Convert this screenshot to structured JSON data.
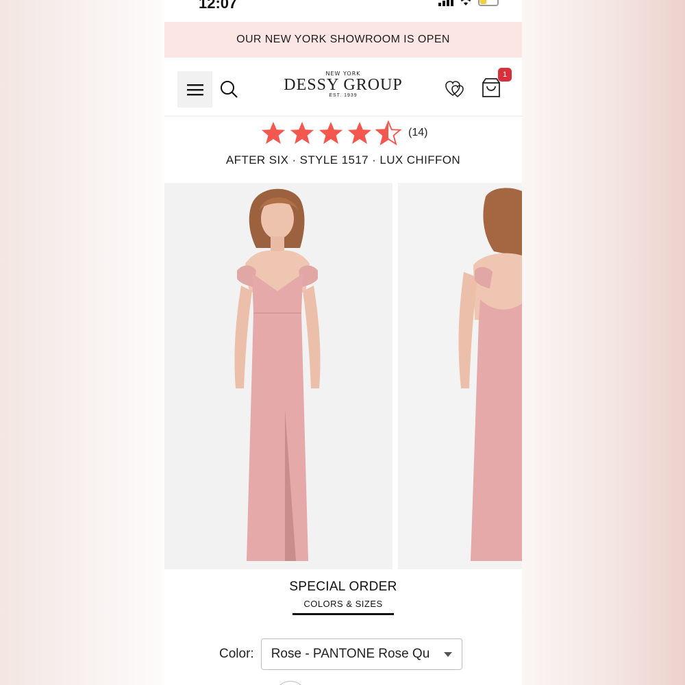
{
  "status": {
    "time": "12:07"
  },
  "banner": {
    "text": "OUR NEW YORK SHOWROOM IS OPEN"
  },
  "header": {
    "logo_top": "NEW YORK",
    "logo_main": "DESSY GROUP",
    "logo_est": "EST. 1939",
    "cart_count": "1",
    "icons": [
      "menu-icon",
      "search-icon",
      "wishlist-hearts-icon",
      "shopping-bag-icon"
    ]
  },
  "rating": {
    "stars": 4.5,
    "max": 5,
    "count_label": "(14)",
    "star_color": "#f4574d"
  },
  "product": {
    "line": "AFTER SIX · STYLE 1517 · LUX CHIFFON"
  },
  "tabs": {
    "title": "SPECIAL ORDER",
    "subtitle": "COLORS & SIZES"
  },
  "color": {
    "label": "Color:",
    "selected": "Rose - PANTONE Rose Quartz"
  },
  "colors": {
    "banner_bg": "#fbe6e4",
    "dress": "#e4a9a8",
    "badge": "#d8303a"
  }
}
